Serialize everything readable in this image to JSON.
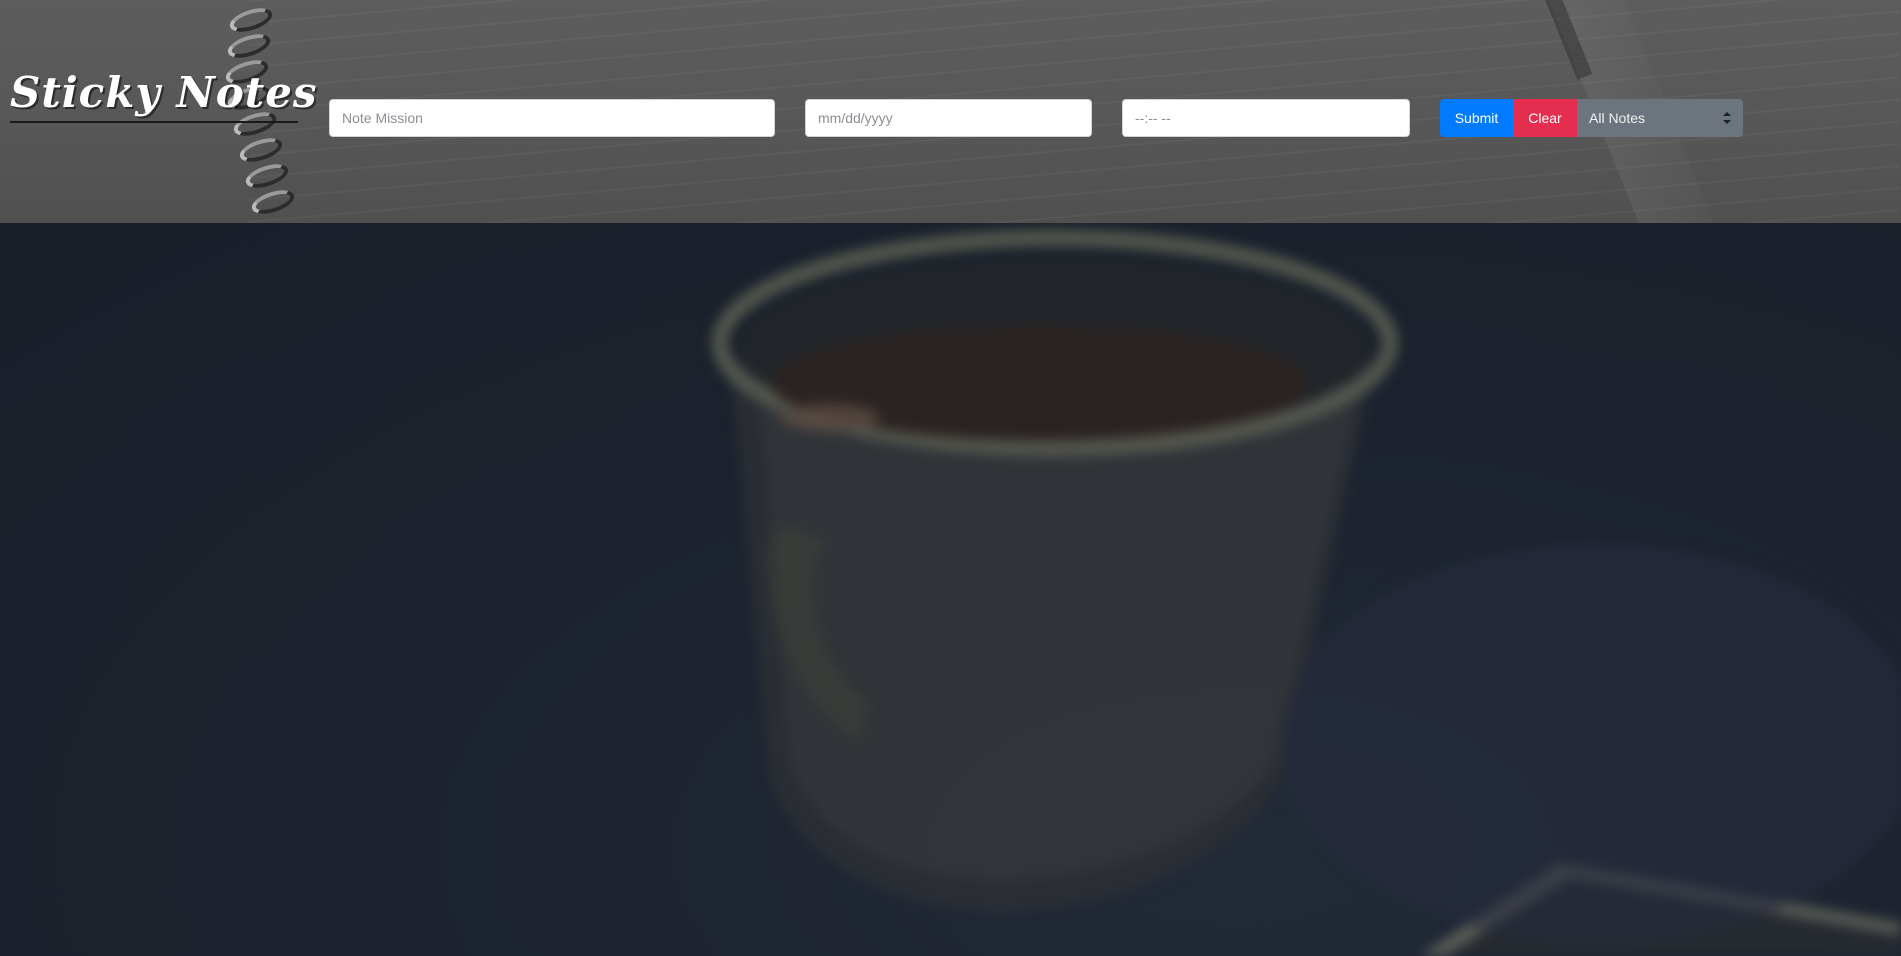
{
  "app": {
    "logo_text": "Sticky Notes"
  },
  "form": {
    "mission_placeholder": "Note Mission",
    "date_placeholder": "mm/dd/yyyy",
    "time_placeholder": "--:-- --",
    "submit_label": "Submit",
    "clear_label": "Clear",
    "filter": {
      "selected": "All Notes"
    }
  },
  "colors": {
    "submit": "#007bff",
    "clear": "#e52d50",
    "select": "#6c757d",
    "background": "#1b222d"
  }
}
